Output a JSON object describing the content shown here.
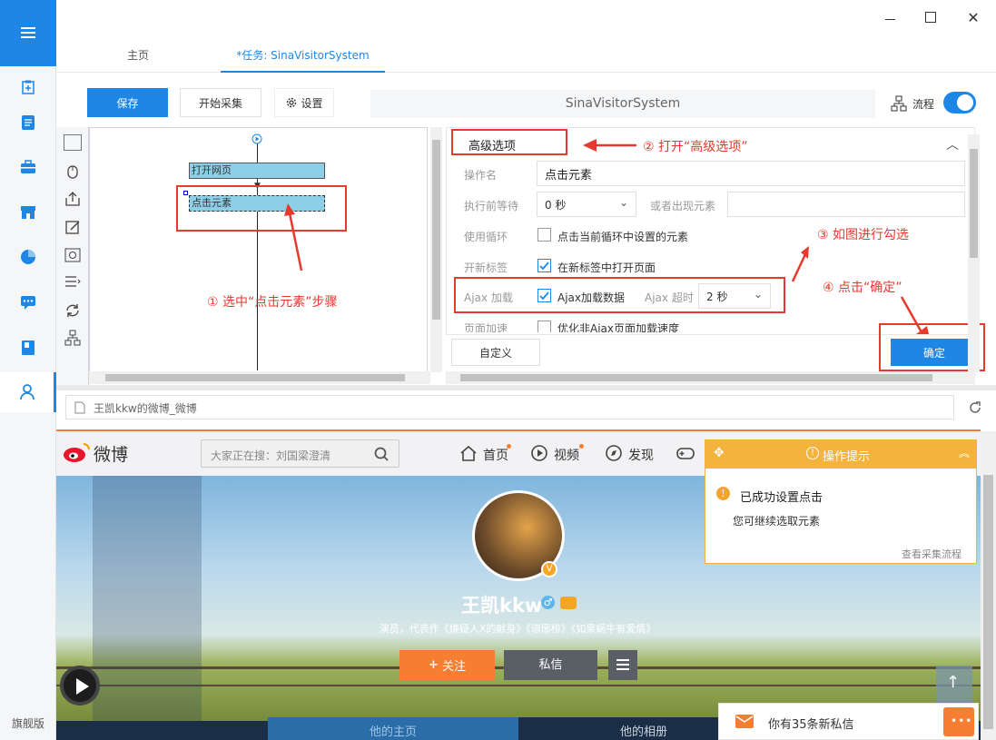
{
  "nav": {
    "edition": "旗舰版"
  },
  "tabs": [
    {
      "label": "主页"
    },
    {
      "label": "*任务: SinaVisitorSystem"
    }
  ],
  "toolbar": {
    "save": "保存",
    "start": "开始采集",
    "settings": "设置",
    "task_name": "SinaVisitorSystem",
    "flow": "流程"
  },
  "flow": {
    "step1": "打开网页",
    "step2": "点击元素"
  },
  "annotations": {
    "a1": "① 选中“点击元素”步骤",
    "a2": "② 打开“高级选项”",
    "a3": "③ 如图进行勾选",
    "a4": "④ 点击“确定”"
  },
  "advanced": {
    "title": "高级选项",
    "op_label": "操作名",
    "op_value": "点击元素",
    "wait_label": "执行前等待",
    "wait_value": "0 秒",
    "or_label": "或者出现元素",
    "loop_label": "使用循环",
    "loop_text": "点击当前循环中设置的元素",
    "newtab_label": "开新标签",
    "newtab_text": "在新标签中打开页面",
    "ajax_label": "Ajax 加载",
    "ajax_text": "Ajax加载数据",
    "timeout_label": "Ajax 超时",
    "timeout_value": "2 秒",
    "speed_label": "页面加速",
    "speed_text": "优化非Ajax页面加载速度",
    "custom": "自定义",
    "ok": "确定"
  },
  "browser": {
    "title": "王凯kkw的微博_微博"
  },
  "weibo": {
    "logo": "微博",
    "search_placeholder": "大家正在搜：刘国梁澄清",
    "nav": [
      "首页",
      "视频",
      "发现"
    ],
    "name": "王凯kkw",
    "bio": "演员，代表作《嫌疑人X的献身》《琅琊榜》《如果蜗牛有爱情》",
    "follow": "关注",
    "message": "私信",
    "tabs": [
      "他的主页",
      "他的相册"
    ],
    "msg_bar": "你有35条新私信"
  },
  "tip": {
    "title": "操作提示",
    "line1": "已成功设置点击",
    "line2": "您可继续选取元素",
    "link": "查看采集流程"
  },
  "colors": {
    "accent": "#1e87e6",
    "annotation": "#e63a2e",
    "tip": "#f4b33d",
    "follow": "#f57e32"
  }
}
